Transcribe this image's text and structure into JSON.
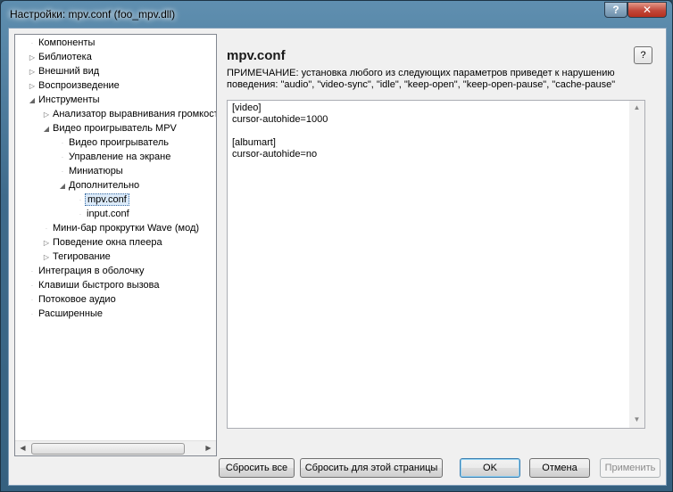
{
  "window": {
    "title": "Настройки: mpv.conf (foo_mpv.dll)",
    "help_label": "?",
    "close_label": "✕"
  },
  "tree": {
    "items": [
      {
        "label": "Компоненты",
        "level": 0,
        "expander": "none"
      },
      {
        "label": "Библиотека",
        "level": 0,
        "expander": "collapsed"
      },
      {
        "label": "Внешний вид",
        "level": 0,
        "expander": "collapsed"
      },
      {
        "label": "Воспроизведение",
        "level": 0,
        "expander": "collapsed"
      },
      {
        "label": "Инструменты",
        "level": 0,
        "expander": "expanded"
      },
      {
        "label": "Анализатор выравнивания громкости",
        "level": 1,
        "expander": "collapsed"
      },
      {
        "label": "Видео проигрыватель MPV",
        "level": 1,
        "expander": "expanded"
      },
      {
        "label": "Видео проигрыватель",
        "level": 2,
        "expander": "none"
      },
      {
        "label": "Управление на экране",
        "level": 2,
        "expander": "none"
      },
      {
        "label": "Миниатюры",
        "level": 2,
        "expander": "none"
      },
      {
        "label": "Дополнительно",
        "level": 2,
        "expander": "expanded"
      },
      {
        "label": "mpv.conf",
        "level": 3,
        "expander": "none",
        "selected": true
      },
      {
        "label": "input.conf",
        "level": 3,
        "expander": "none"
      },
      {
        "label": "Мини-бар прокрутки Wave (мод)",
        "level": 1,
        "expander": "none"
      },
      {
        "label": "Поведение окна плеера",
        "level": 1,
        "expander": "collapsed"
      },
      {
        "label": "Тегирование",
        "level": 1,
        "expander": "collapsed"
      },
      {
        "label": "Интеграция в оболочку",
        "level": 0,
        "expander": "none"
      },
      {
        "label": "Клавиши быстрого вызова",
        "level": 0,
        "expander": "none"
      },
      {
        "label": "Потоковое аудио",
        "level": 0,
        "expander": "none"
      },
      {
        "label": "Расширенные",
        "level": 0,
        "expander": "none"
      }
    ]
  },
  "page": {
    "title": "mpv.conf",
    "help_label": "?",
    "note_line1": "ПРИМЕЧАНИЕ: установка любого из следующих параметров приведет к нарушению",
    "note_line2": "поведения: \"audio\", \"video-sync\", \"idle\", \"keep-open\", \"keep-open-pause\", \"cache-pause\"",
    "editor_text": "[video]\ncursor-autohide=1000\n\n[albumart]\ncursor-autohide=no"
  },
  "buttons": {
    "reset_all": "Сбросить все",
    "reset_page": "Сбросить для этой страницы",
    "ok": "OK",
    "cancel": "Отмена",
    "apply": "Применить"
  }
}
